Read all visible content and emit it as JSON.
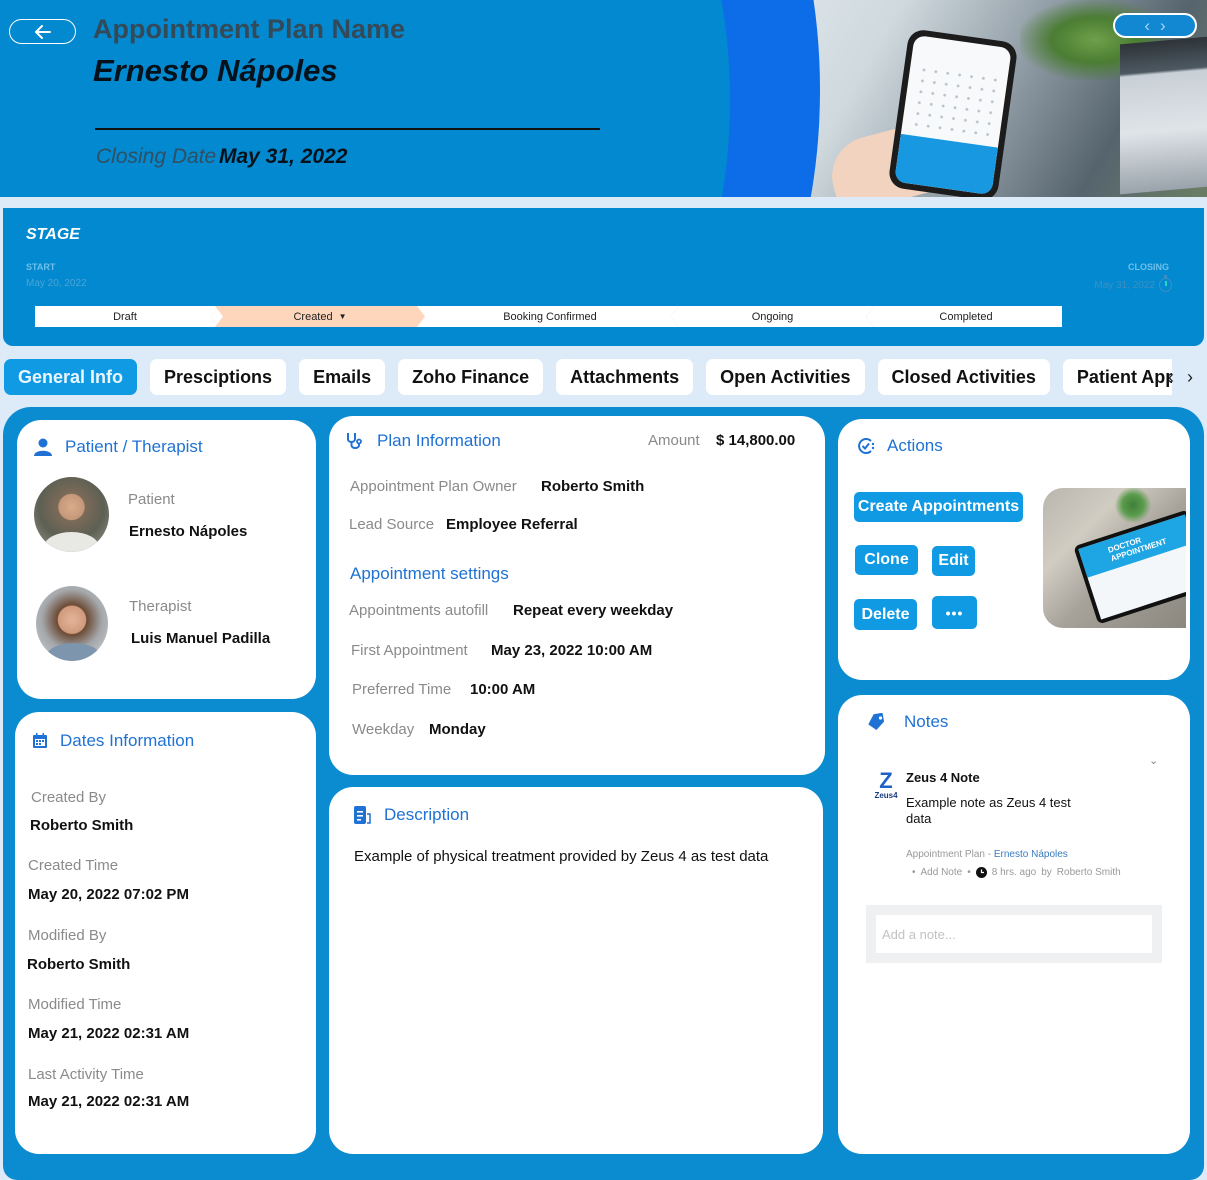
{
  "header": {
    "back_icon": "arrow-left-icon",
    "plan_label": "Appointment Plan Name",
    "plan_name": "Ernesto Nápoles",
    "closing_label": "Closing Date",
    "closing_value": "May 31, 2022",
    "nav_prev": "‹",
    "nav_next": "›"
  },
  "stage": {
    "title": "STAGE",
    "start_label": "START",
    "start_date": "May 20, 2022",
    "closing_label": "CLOSING",
    "closing_date": "May 31, 2022",
    "steps": [
      {
        "label": "Draft",
        "active": false
      },
      {
        "label": "Created",
        "active": true
      },
      {
        "label": "Booking Confirmed",
        "active": false
      },
      {
        "label": "Ongoing",
        "active": false
      },
      {
        "label": "Completed",
        "active": false
      }
    ],
    "active_caret": "▼"
  },
  "tabs": [
    {
      "label": "General Info",
      "active": true
    },
    {
      "label": "Presciptions"
    },
    {
      "label": "Emails"
    },
    {
      "label": "Zoho Finance"
    },
    {
      "label": "Attachments"
    },
    {
      "label": "Open Activities"
    },
    {
      "label": "Closed Activities"
    },
    {
      "label": "Patient Appointme"
    }
  ],
  "tab_scroll": {
    "prev": "‹",
    "next": "›"
  },
  "patient_card": {
    "title": "Patient / Therapist",
    "patient_label": "Patient",
    "patient_name": "Ernesto Nápoles",
    "therapist_label": "Therapist",
    "therapist_name": "Luis Manuel Padilla"
  },
  "dates_card": {
    "title": "Dates Information",
    "fields": [
      {
        "label": "Created By",
        "value": "Roberto Smith"
      },
      {
        "label": "Created Time",
        "value": "May 20, 2022 07:02 PM"
      },
      {
        "label": "Modified By",
        "value": "Roberto Smith"
      },
      {
        "label": "Modified Time",
        "value": "May 21, 2022 02:31 AM"
      },
      {
        "label": "Last Activity Time",
        "value": "May 21, 2022 02:31 AM"
      }
    ]
  },
  "plan_card": {
    "title": "Plan Information",
    "amount_label": "Amount",
    "amount_value": "$ 14,800.00",
    "owner_label": "Appointment Plan Owner",
    "owner_value": "Roberto Smith",
    "lead_label": "Lead Source",
    "lead_value": "Employee Referral",
    "settings_title": "Appointment settings",
    "autofill_label": "Appointments autofill",
    "autofill_value": "Repeat every weekday",
    "first_label": "First Appointment",
    "first_value": "May 23, 2022 10:00 AM",
    "pref_label": "Preferred Time",
    "pref_value": "10:00 AM",
    "weekday_label": "Weekday",
    "weekday_value": "Monday"
  },
  "description_card": {
    "title": "Description",
    "text": "Example of physical treatment provided by Zeus 4 as test data"
  },
  "actions_card": {
    "title": "Actions",
    "create_label": "Create Appointments",
    "clone_label": "Clone",
    "edit_label": "Edit",
    "delete_label": "Delete",
    "more_label": "•••",
    "image_caption": "DOCTOR APPOINTMENT"
  },
  "notes_card": {
    "title": "Notes",
    "logo_text": "Zeus4",
    "note_title": "Zeus 4 Note",
    "note_body": "Example note as Zeus 4 test data",
    "context_label": "Appointment Plan",
    "context_sep": "-",
    "context_link": "Ernesto Nápoles",
    "add_note_link": "Add Note",
    "time_ago": "8 hrs. ago",
    "by_label": "by",
    "author": "Roberto Smith",
    "input_placeholder": "Add a note..."
  },
  "colors": {
    "brand_blue": "#0389cf",
    "heading_blue": "#1f72d3",
    "button_blue": "#109ae4",
    "active_stage": "#fdd6bb",
    "page_bg": "#ddebf9"
  }
}
